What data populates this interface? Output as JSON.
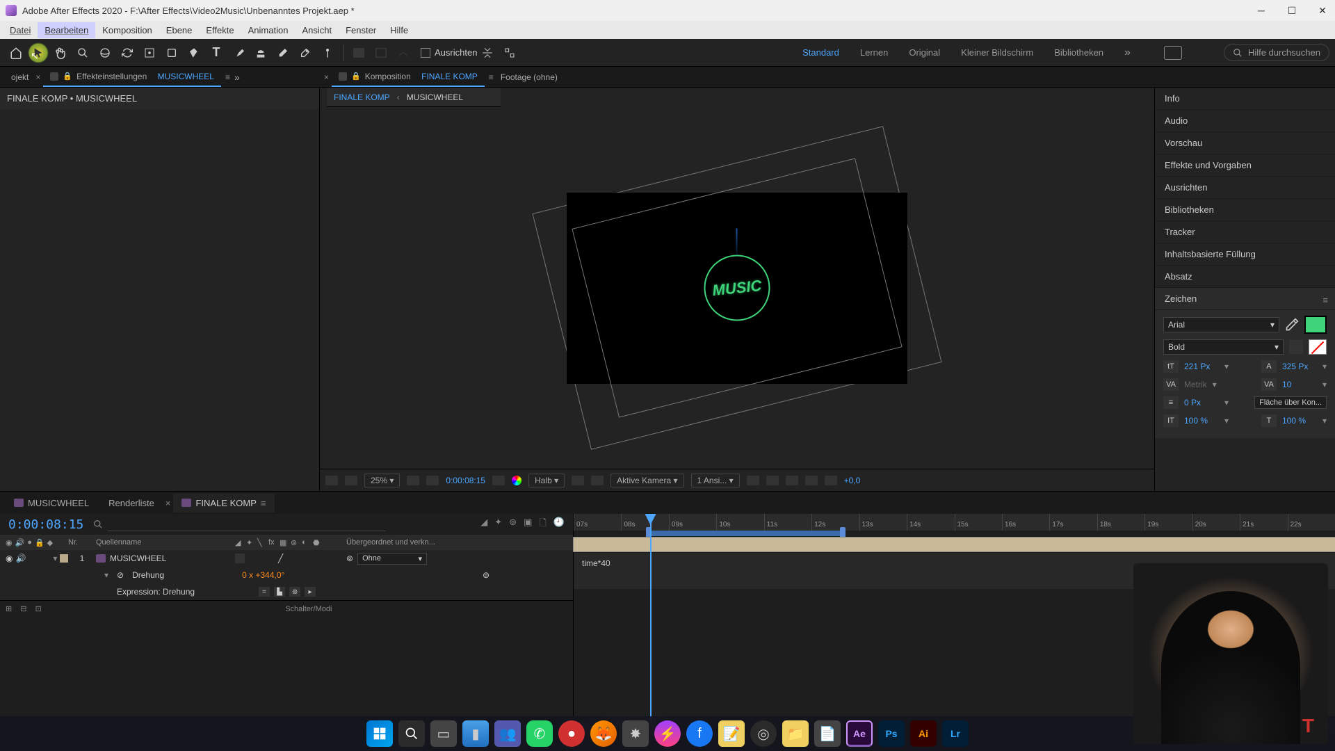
{
  "app": {
    "title": "Adobe After Effects 2020 - F:\\After Effects\\Video2Music\\Unbenanntes Projekt.aep *"
  },
  "menu": {
    "items": [
      "Datei",
      "Bearbeiten",
      "Komposition",
      "Ebene",
      "Effekte",
      "Animation",
      "Ansicht",
      "Fenster",
      "Hilfe"
    ]
  },
  "toolbar": {
    "ausrichten": "Ausrichten"
  },
  "workspace": {
    "items": [
      "Standard",
      "Lernen",
      "Original",
      "Kleiner Bildschirm",
      "Bibliotheken"
    ],
    "help_search": "Hilfe durchsuchen"
  },
  "left_panel": {
    "tab_label": "ojekt",
    "fx_label": "Effekteinstellungen",
    "fx_target": "MUSICWHEEL",
    "breadcrumb": "FINALE KOMP • MUSICWHEEL"
  },
  "comp_panel": {
    "tab_label": "Komposition",
    "tab_target": "FINALE KOMP",
    "footage_label": "Footage (ohne)",
    "flow_active": "FINALE KOMP",
    "flow_next": "MUSICWHEEL",
    "viewer_text": "MUSIC",
    "footer": {
      "zoom": "25%",
      "timecode": "0:00:08:15",
      "res": "Halb",
      "camera": "Aktive Kamera",
      "views": "1 Ansi...",
      "exposure": "+0,0"
    }
  },
  "right_panels": {
    "items": [
      "Info",
      "Audio",
      "Vorschau",
      "Effekte und Vorgaben",
      "Ausrichten",
      "Bibliotheken",
      "Tracker",
      "Inhaltsbasierte Füllung",
      "Absatz"
    ],
    "zeichen": "Zeichen"
  },
  "char_panel": {
    "font": "Arial",
    "weight": "Bold",
    "size": "221 Px",
    "leading": "325 Px",
    "kerning": "Metrik",
    "tracking": "10",
    "stroke": "0 Px",
    "stroke_opt": "Fläche über Kon...",
    "scale_v": "100 %",
    "scale_h": "100 %"
  },
  "timeline": {
    "tabs": {
      "t1": "MUSICWHEEL",
      "t2": "Renderliste",
      "t3": "FINALE KOMP"
    },
    "timecode": "0:00:08:15",
    "col_nr": "Nr.",
    "col_name": "Quellenname",
    "col_parent": "Übergeordnet und verkn...",
    "layer1": {
      "nr": "1",
      "name": "MUSICWHEEL",
      "parent": "Ohne"
    },
    "prop_rotation": "Drehung",
    "rot_val_turns": "0 x",
    "rot_val_deg": "+344,0",
    "rot_val_suffix": "°",
    "expr_label": "Expression: Drehung",
    "expr_code": "time*40",
    "ruler": [
      "07s",
      "08s",
      "09s",
      "10s",
      "11s",
      "12s",
      "13s",
      "14s",
      "15s",
      "16s",
      "17s",
      "18s",
      "19s",
      "20s",
      "21s",
      "22s"
    ],
    "footer_toggle": "Schalter/Modi"
  },
  "taskbar": {
    "ae": "Ae",
    "ps": "Ps",
    "ai": "Ai",
    "lr": "Lr"
  }
}
